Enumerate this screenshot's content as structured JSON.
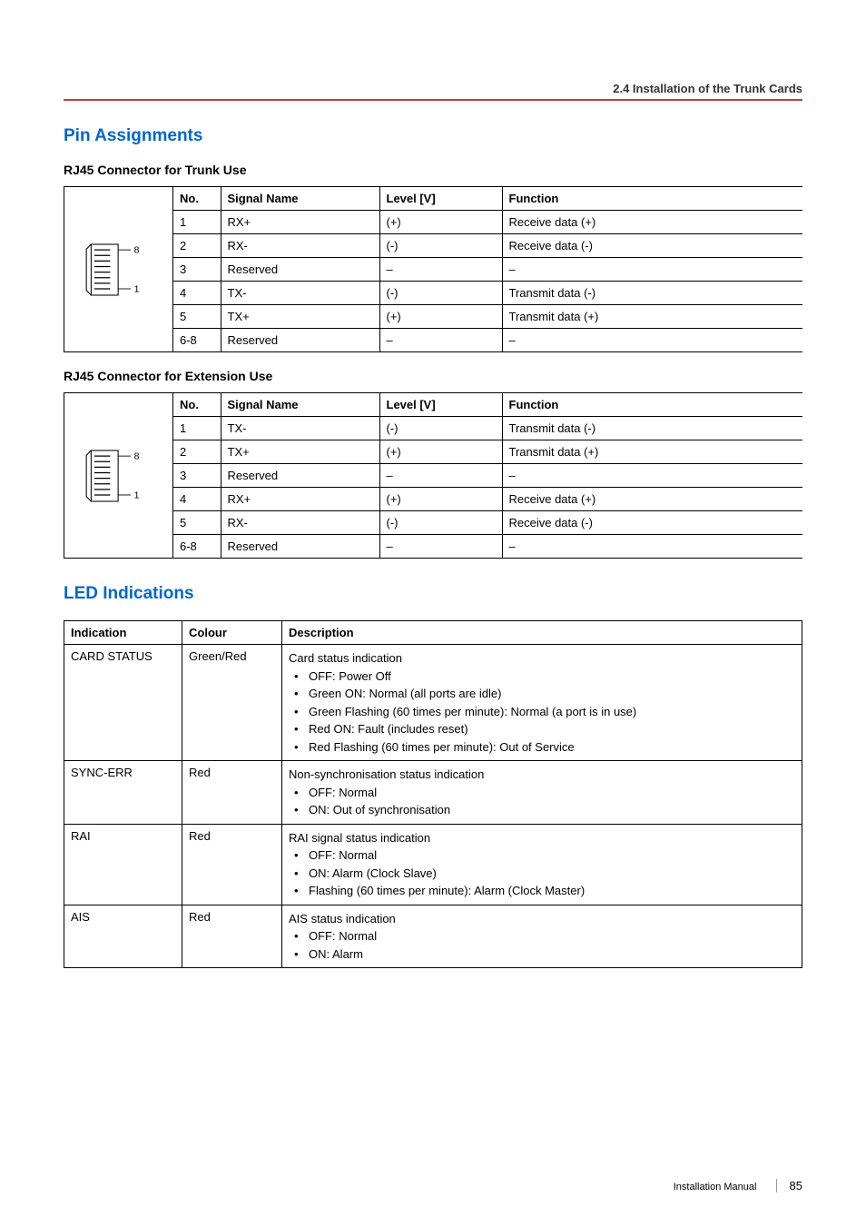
{
  "header": {
    "breadcrumb": "2.4 Installation of the Trunk Cards"
  },
  "section1": {
    "title": "Pin Assignments",
    "sub1": "RJ45 Connector for Trunk Use",
    "sub2": "RJ45 Connector for Extension Use",
    "headers": {
      "no": "No.",
      "signal": "Signal Name",
      "level": "Level [V]",
      "func": "Function"
    },
    "diagram": {
      "topLabel": "8",
      "bottomLabel": "1"
    },
    "trunk": [
      {
        "no": "1",
        "signal": "RX+",
        "level": "(+)",
        "func": "Receive data (+)"
      },
      {
        "no": "2",
        "signal": "RX-",
        "level": "(-)",
        "func": "Receive data (-)"
      },
      {
        "no": "3",
        "signal": "Reserved",
        "level": "–",
        "func": "–"
      },
      {
        "no": "4",
        "signal": "TX-",
        "level": "(-)",
        "func": "Transmit data (-)"
      },
      {
        "no": "5",
        "signal": "TX+",
        "level": "(+)",
        "func": "Transmit data (+)"
      },
      {
        "no": "6-8",
        "signal": "Reserved",
        "level": "–",
        "func": "–"
      }
    ],
    "ext": [
      {
        "no": "1",
        "signal": "TX-",
        "level": "(-)",
        "func": "Transmit data (-)"
      },
      {
        "no": "2",
        "signal": "TX+",
        "level": "(+)",
        "func": "Transmit data (+)"
      },
      {
        "no": "3",
        "signal": "Reserved",
        "level": "–",
        "func": "–"
      },
      {
        "no": "4",
        "signal": "RX+",
        "level": "(+)",
        "func": "Receive data (+)"
      },
      {
        "no": "5",
        "signal": "RX-",
        "level": "(-)",
        "func": "Receive data (-)"
      },
      {
        "no": "6-8",
        "signal": "Reserved",
        "level": "–",
        "func": "–"
      }
    ]
  },
  "section2": {
    "title": "LED Indications",
    "headers": {
      "ind": "Indication",
      "colour": "Colour",
      "desc": "Description"
    },
    "rows": [
      {
        "ind": "CARD STATUS",
        "colour": "Green/Red",
        "lead": "Card status indication",
        "items": [
          "OFF: Power Off",
          "Green ON: Normal (all ports are idle)",
          "Green Flashing (60 times per minute): Normal (a port is in use)",
          "Red ON: Fault (includes reset)",
          "Red Flashing (60 times per minute): Out of Service"
        ]
      },
      {
        "ind": "SYNC-ERR",
        "colour": "Red",
        "lead": "Non-synchronisation status indication",
        "items": [
          "OFF: Normal",
          "ON: Out of synchronisation"
        ]
      },
      {
        "ind": "RAI",
        "colour": "Red",
        "lead": "RAI signal status indication",
        "items": [
          "OFF: Normal",
          "ON: Alarm (Clock Slave)",
          "Flashing (60 times per minute): Alarm (Clock Master)"
        ]
      },
      {
        "ind": "AIS",
        "colour": "Red",
        "lead": "AIS status indication",
        "items": [
          "OFF: Normal",
          "ON: Alarm"
        ]
      }
    ]
  },
  "footer": {
    "manual": "Installation Manual",
    "page": "85"
  }
}
